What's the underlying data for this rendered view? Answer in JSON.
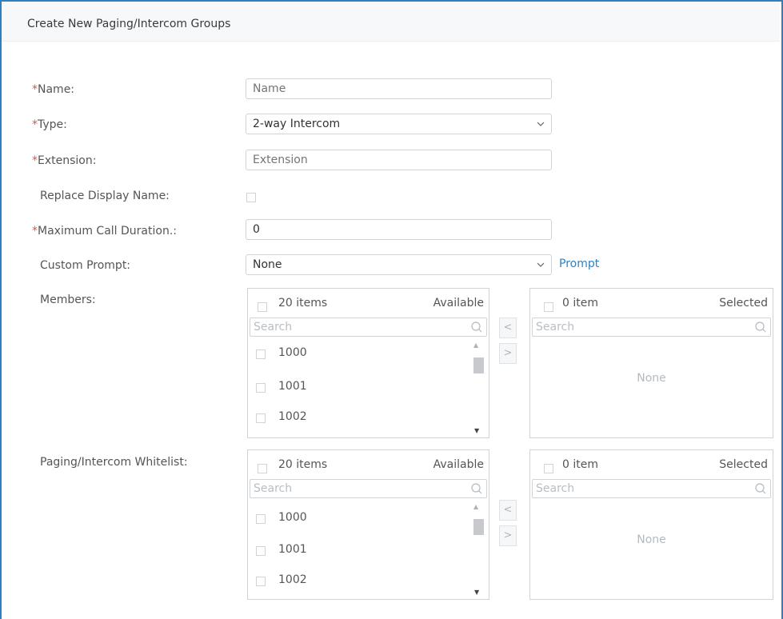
{
  "header": {
    "title": "Create New Paging/Intercom Groups"
  },
  "form": {
    "name": {
      "required_mark": "*",
      "label": "Name:",
      "placeholder": "Name",
      "value": ""
    },
    "type": {
      "required_mark": "*",
      "label": "Type:",
      "value": "2-way Intercom"
    },
    "extension": {
      "required_mark": "*",
      "label": "Extension:",
      "placeholder": "Extension",
      "value": ""
    },
    "replace_display_name": {
      "label": "Replace Display Name:",
      "checked": false
    },
    "max_call_duration": {
      "required_mark": "*",
      "label": "Maximum Call Duration.:",
      "value": "0"
    },
    "custom_prompt": {
      "label": "Custom Prompt:",
      "value": "None",
      "link": "Prompt"
    }
  },
  "members": {
    "label": "Members:",
    "available": {
      "count": "20 items",
      "status": "Available",
      "search_placeholder": "Search",
      "items": [
        "1000",
        "1001",
        "1002"
      ]
    },
    "selected": {
      "count": "0 item",
      "status": "Selected",
      "search_placeholder": "Search",
      "empty": "None"
    },
    "move_left": "<",
    "move_right": ">"
  },
  "whitelist": {
    "label": "Paging/Intercom Whitelist:",
    "available": {
      "count": "20 items",
      "status": "Available",
      "search_placeholder": "Search",
      "items": [
        "1000",
        "1001",
        "1002"
      ]
    },
    "selected": {
      "count": "0 item",
      "status": "Selected",
      "search_placeholder": "Search",
      "empty": "None"
    },
    "move_left": "<",
    "move_right": ">"
  },
  "icons": {
    "chevron": "chevron-down-icon",
    "search": "search-icon",
    "scroll_up": "triangle-up-icon",
    "scroll_down": "triangle-down-icon"
  },
  "colors": {
    "accent": "#2f7fc1",
    "required": "#d9534f",
    "link": "#2f82c3"
  }
}
